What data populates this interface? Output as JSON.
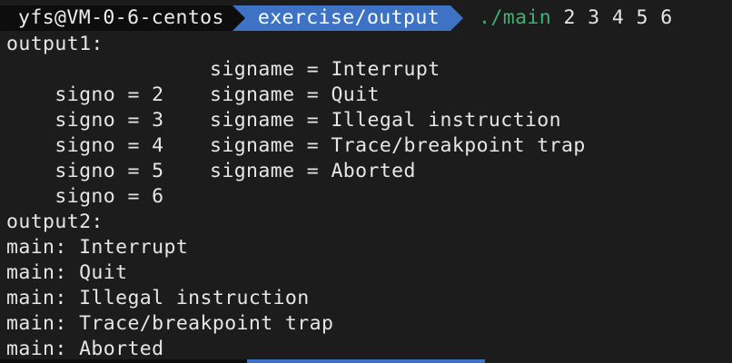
{
  "prompt": {
    "user_host": "yfs@VM-0-6-centos",
    "path": "exercise/output",
    "command": "./main",
    "args": " 2 3 4 5 6"
  },
  "output1": {
    "heading": "output1:",
    "rows": [
      {
        "signo": "signo = 2",
        "signame": "signame = Interrupt"
      },
      {
        "signo": "signo = 3",
        "signame": "signame = Quit"
      },
      {
        "signo": "signo = 4",
        "signame": "signame = Illegal instruction"
      },
      {
        "signo": "signo = 5",
        "signame": "signame = Trace/breakpoint trap"
      },
      {
        "signo": "signo = 6",
        "signame": "signame = Aborted"
      }
    ]
  },
  "output2": {
    "heading": "output2:",
    "lines": [
      "main: Interrupt",
      "main: Quit",
      "main: Illegal instruction",
      "main: Trace/breakpoint trap",
      "main: Aborted"
    ]
  },
  "colors": {
    "background": "#1c1c1c",
    "text": "#e6e6e6",
    "prompt_user_bg": "#0d0d0d",
    "prompt_path_bg": "#3d72c4",
    "command_green": "#3cb371"
  }
}
